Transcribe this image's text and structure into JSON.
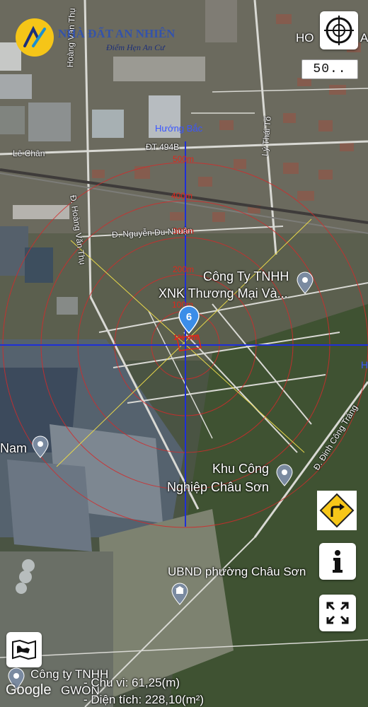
{
  "brand": {
    "name": "NHÀ ĐẤT AN NHIÊN",
    "slogan": "Điểm Hẹn An Cư"
  },
  "compass": {
    "label": "Hướng Bắc"
  },
  "scale": {
    "value": "50.."
  },
  "partial_labels": {
    "top_right_poi": "HO",
    "top_right_edge": "A",
    "right_edge_h": "H",
    "left_edge_nam": "Nam"
  },
  "streets": {
    "le_chan": "Lê Chân",
    "dt494b": "ĐT 494B",
    "hoang_van_thu_top": "Hoàng Văn Thụ",
    "hoang_van_thu": "Đ. Hoàng Văn Thụ",
    "ly_thai_to": "Lý Thái Tổ",
    "nguyen_du_nhuan": "Đ. Nguyễn Du Nhuận",
    "dinh_cong_trang": "Đ. Đinh Công Tráng"
  },
  "distance_labels": [
    "500m",
    "400m",
    "300m",
    "200m",
    "100m"
  ],
  "marker": {
    "number": "6",
    "label": "1% 4m"
  },
  "places": {
    "cong_ty_xnk_line1": "Công Ty TNHH",
    "cong_ty_xnk_line2": "XNK Thương Mại Và...",
    "kcn_line1": "Khu Công",
    "kcn_line2": "Nghiệp Châu Sơn",
    "ubnd": "UBND phường Châu Sơn",
    "cong_ty_bottom_line1": "Công ty TNHH",
    "cong_ty_bottom_line2": "GWON"
  },
  "footer": {
    "google": "Google",
    "perimeter": "- Chu vi: 61,25(m)",
    "area": "- Diện tích: 228,10(m²)"
  },
  "buttons": {
    "locate_icon": "crosshair-icon",
    "directions_icon": "turn-right-sign-icon",
    "info_icon": "info-icon",
    "fullscreen_icon": "expand-icon",
    "map_layers_icon": "map-icon"
  },
  "colors": {
    "grid_line": "#1f2fd8",
    "circle": "#d22b2b",
    "distance_text": "#e0261b",
    "marker": "#3b8de8",
    "yellow_line": "#e8d84a"
  }
}
